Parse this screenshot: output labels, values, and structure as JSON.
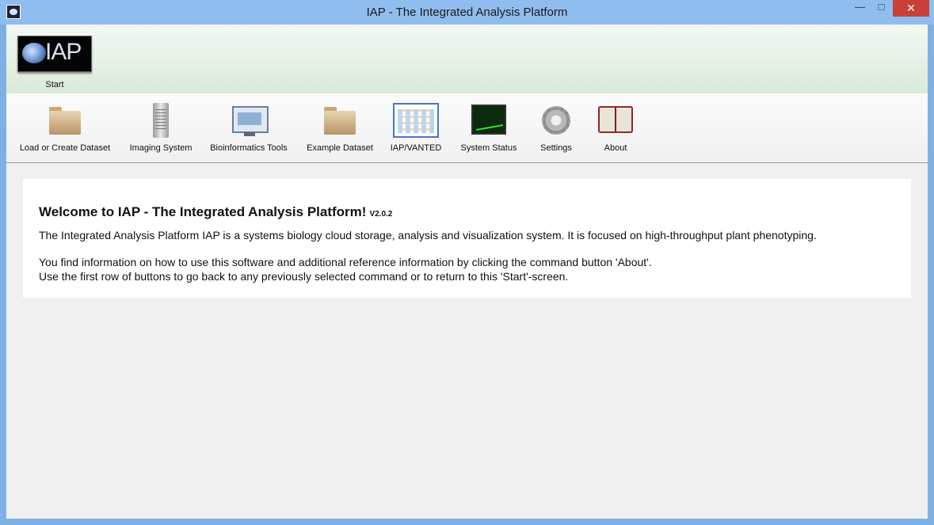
{
  "window": {
    "title": "IAP - The Integrated Analysis Platform",
    "minimize_icon": "minimize-icon",
    "maximize_icon": "maximize-icon",
    "close_icon": "close-icon"
  },
  "start": {
    "logo_text": "IAP",
    "label": "Start"
  },
  "toolbar": [
    {
      "label": "Load or Create Dataset",
      "icon": "open-folder-icon"
    },
    {
      "label": "Imaging System",
      "icon": "server-icon"
    },
    {
      "label": "Bioinformatics Tools",
      "icon": "monitor-icon"
    },
    {
      "label": "Example Dataset",
      "icon": "folder-icon"
    },
    {
      "label": "IAP/VANTED",
      "icon": "vanted-graph-icon"
    },
    {
      "label": "System Status",
      "icon": "system-monitor-icon"
    },
    {
      "label": "Settings",
      "icon": "gear-icon"
    },
    {
      "label": "About",
      "icon": "book-icon"
    }
  ],
  "content": {
    "heading": "Welcome to IAP - The Integrated Analysis Platform!",
    "version": "V2.0.2",
    "paragraph1": "The Integrated Analysis Platform IAP is a systems biology cloud storage, analysis and visualization system. It is focused on high-throughput plant phenotyping.",
    "paragraph2": "You find information on how to use this software and additional reference information by clicking the command button 'About'.",
    "paragraph3": "Use the first row of buttons to go back to any previously selected command or to return to this 'Start'-screen."
  }
}
